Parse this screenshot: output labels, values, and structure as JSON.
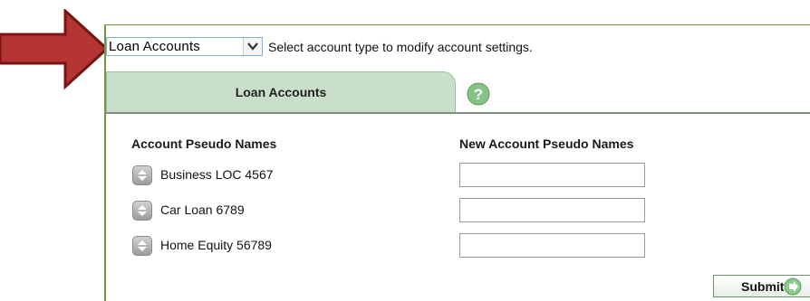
{
  "account_selector": {
    "selected": "Loan Accounts",
    "hint": "Select account type to modify account settings."
  },
  "tabs": {
    "active_label": "Loan Accounts"
  },
  "table": {
    "col_current": "Account Pseudo Names",
    "col_new": "New Account Pseudo Names",
    "rows": [
      {
        "name": "Business LOC 4567",
        "new_value": ""
      },
      {
        "name": "Car Loan 6789",
        "new_value": ""
      },
      {
        "name": "Home Equity 56789",
        "new_value": ""
      }
    ]
  },
  "actions": {
    "submit_label": "Submit"
  },
  "colors": {
    "panel_border": "#6f9a3a",
    "tab_active": "#c9dfc9",
    "arrow": "#b32d2d",
    "help_icon": "#7fbf7f"
  },
  "icons": {
    "arrow": "red-arrow-icon",
    "dropdown": "chevron-down-icon",
    "help": "help-question-icon",
    "sort": "up-down-sort-icon",
    "submit": "arrow-right-circle-icon"
  }
}
